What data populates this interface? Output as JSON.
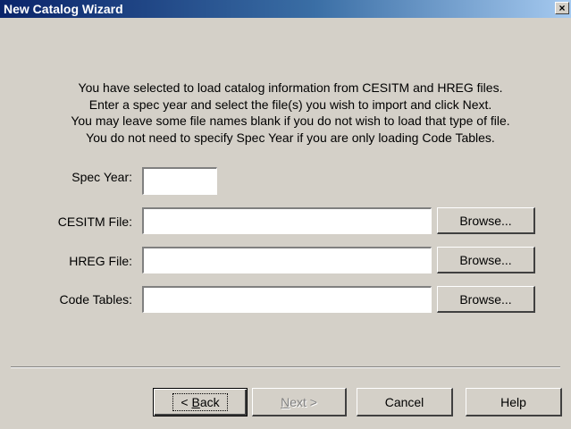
{
  "window": {
    "title": "New Catalog Wizard",
    "close_glyph": "×"
  },
  "instructions": [
    "You have selected to load catalog information from CESITM and HREG files.",
    "Enter a spec year and select the file(s) you wish to import and click Next.",
    "You may leave some file names blank if you do not wish to load that type of file.",
    "You do not need to specify Spec Year if you are only loading Code Tables."
  ],
  "form": {
    "spec_year": {
      "label": "Spec Year:",
      "value": ""
    },
    "cesitm": {
      "label": "CESITM File:",
      "value": "",
      "browse": "Browse..."
    },
    "hreg": {
      "label": "HREG File:",
      "value": "",
      "browse": "Browse..."
    },
    "code_tables": {
      "label": "Code Tables:",
      "value": "",
      "browse": "Browse..."
    }
  },
  "buttons": {
    "back_prefix": "< ",
    "back_key": "B",
    "back_rest": "ack",
    "next_key": "N",
    "next_rest": "ext >",
    "cancel": "Cancel",
    "help": "Help"
  },
  "colors": {
    "dialog_bg": "#d4d0c8",
    "titlebar_start": "#0a246a",
    "titlebar_end": "#a6caf0"
  }
}
